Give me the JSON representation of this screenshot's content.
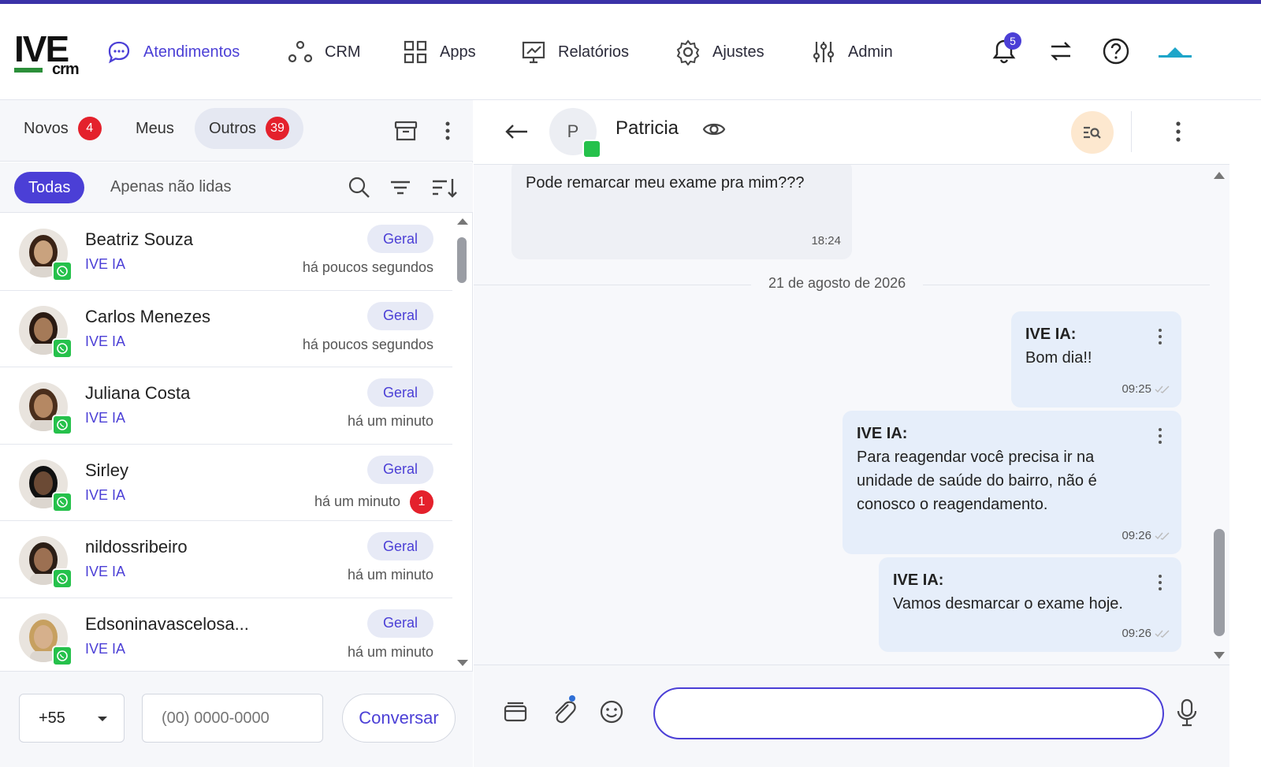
{
  "brand": {
    "logo_main": "IVE",
    "logo_sub": "crm"
  },
  "nav": [
    {
      "label": "Atendimentos",
      "icon": "chat-bubble-icon",
      "active": true
    },
    {
      "label": "CRM",
      "icon": "network-icon"
    },
    {
      "label": "Apps",
      "icon": "grid-icon"
    },
    {
      "label": "Relatórios",
      "icon": "presentation-chart-icon"
    },
    {
      "label": "Ajustes",
      "icon": "gear-icon"
    },
    {
      "label": "Admin",
      "icon": "sliders-icon"
    }
  ],
  "header_right": {
    "notifications_count": "5"
  },
  "left_tabs": [
    {
      "label": "Novos",
      "count": "4"
    },
    {
      "label": "Meus",
      "count": ""
    },
    {
      "label": "Outros",
      "count": "39"
    }
  ],
  "filters": {
    "all": "Todas",
    "unread": "Apenas não lidas"
  },
  "contacts": [
    {
      "name": "Beatriz Souza",
      "agent": "IVE IA",
      "tag": "Geral",
      "time": "há poucos segundos",
      "unread": ""
    },
    {
      "name": "Carlos Menezes",
      "agent": "IVE IA",
      "tag": "Geral",
      "time": "há poucos segundos",
      "unread": ""
    },
    {
      "name": "Juliana Costa",
      "agent": "IVE IA",
      "tag": "Geral",
      "time": "há um minuto",
      "unread": ""
    },
    {
      "name": "Sirley",
      "agent": "IVE IA",
      "tag": "Geral",
      "time": "há um minuto",
      "unread": "1"
    },
    {
      "name": "nildossribeiro",
      "agent": "IVE IA",
      "tag": "Geral",
      "time": "há um minuto",
      "unread": ""
    },
    {
      "name": "Edsoninavascelosa...",
      "agent": "IVE IA",
      "tag": "Geral",
      "time": "há um minuto",
      "unread": ""
    }
  ],
  "new_chat": {
    "country_code": "+55",
    "phone_placeholder": "(00) 0000-0000",
    "button": "Conversar"
  },
  "chat": {
    "contact_initial": "P",
    "contact_name": "Patricia",
    "incoming": {
      "text": "Pode remarcar meu exame pra mim???",
      "time": "18:24"
    },
    "date_separator": "21 de agosto de 2026",
    "outgoing": [
      {
        "sender": "IVE IA:",
        "text": "Bom dia!!",
        "time": "09:25"
      },
      {
        "sender": "IVE IA:",
        "text": "Para reagendar você precisa ir na unidade de saúde do bairro, não é conosco o reagendamento.",
        "time": "09:26"
      },
      {
        "sender": "IVE IA:",
        "text": "Vamos desmarcar o exame hoje.",
        "time": "09:26"
      }
    ]
  },
  "colors": {
    "accent": "#4b3fd6",
    "badge_red": "#e4212c",
    "whatsapp": "#25c14b"
  }
}
